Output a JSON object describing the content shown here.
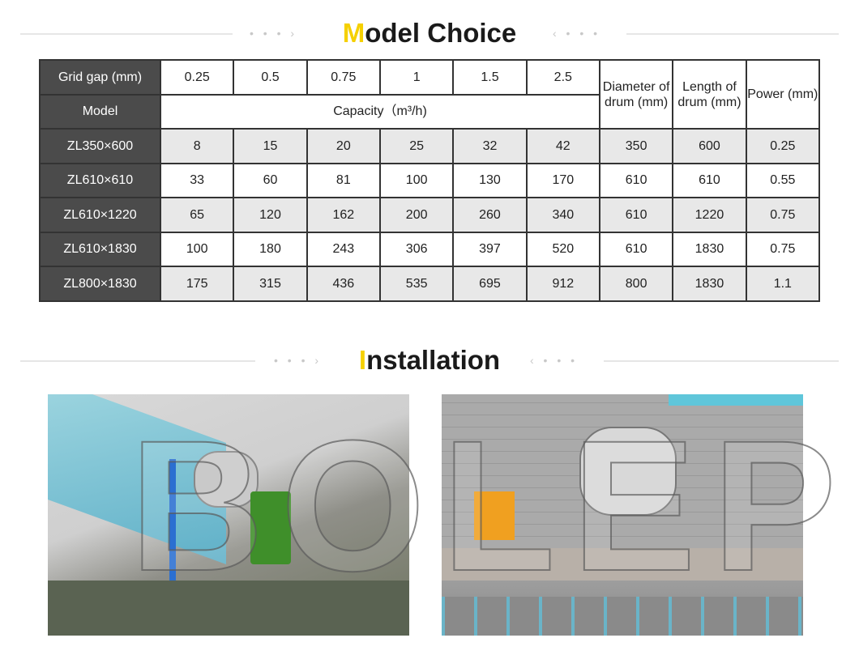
{
  "model_section": {
    "title_first": "M",
    "title_rest": "odel Choice",
    "dots_left": "• • • ›",
    "dots_right": "‹ • • •"
  },
  "install_section": {
    "title_first": "I",
    "title_rest": "nstallation",
    "dots_left": "• • • ›",
    "dots_right": "‹ • • •"
  },
  "table": {
    "grid_gap_label": "Grid gap (mm)",
    "grid_gaps": [
      "0.25",
      "0.5",
      "0.75",
      "1",
      "1.5",
      "2.5"
    ],
    "diameter_label": "Diameter of drum (mm)",
    "length_label": "Length of drum (mm)",
    "power_label": "Power (mm)",
    "model_label": "Model",
    "capacity_label": "Capacity（m³/h)",
    "rows": [
      {
        "model": "ZL350×600",
        "values": [
          "8",
          "15",
          "20",
          "25",
          "32",
          "42",
          "350",
          "600",
          "0.25"
        ]
      },
      {
        "model": "ZL610×610",
        "values": [
          "33",
          "60",
          "81",
          "100",
          "130",
          "170",
          "610",
          "610",
          "0.55"
        ]
      },
      {
        "model": "ZL610×1220",
        "values": [
          "65",
          "120",
          "162",
          "200",
          "260",
          "340",
          "610",
          "1220",
          "0.75"
        ]
      },
      {
        "model": "ZL610×1830",
        "values": [
          "100",
          "180",
          "243",
          "306",
          "397",
          "520",
          "610",
          "1830",
          "0.75"
        ]
      },
      {
        "model": "ZL800×1830",
        "values": [
          "175",
          "315",
          "436",
          "535",
          "695",
          "912",
          "800",
          "1830",
          "1.1"
        ]
      }
    ]
  },
  "watermark": "BOLEP",
  "colors": {
    "accent": "#f5d000",
    "header_cell": "#4b4b4b",
    "alt_row": "#e8e8e8"
  }
}
